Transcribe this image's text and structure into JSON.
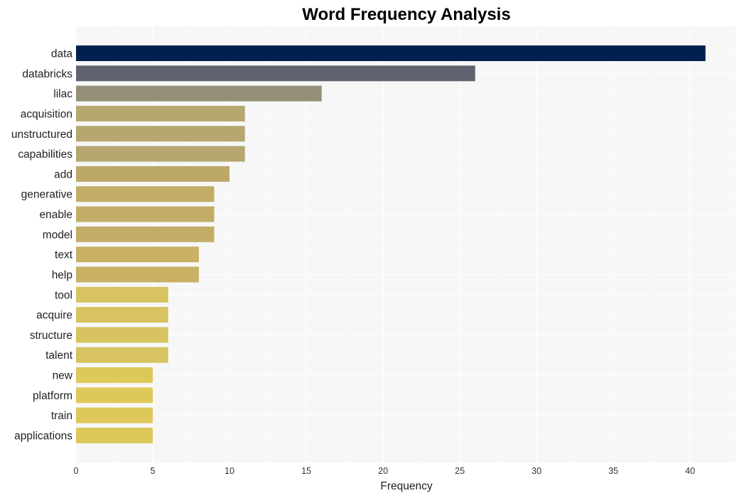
{
  "chart_data": {
    "type": "bar",
    "orientation": "horizontal",
    "title": "Word Frequency Analysis",
    "xlabel": "Frequency",
    "ylabel": "",
    "xlim": [
      0,
      43
    ],
    "xticks": [
      0,
      5,
      10,
      15,
      20,
      25,
      30,
      35,
      40
    ],
    "grid": true,
    "legend": "none",
    "categories": [
      "data",
      "databricks",
      "lilac",
      "acquisition",
      "unstructured",
      "capabilities",
      "add",
      "generative",
      "enable",
      "model",
      "text",
      "help",
      "tool",
      "acquire",
      "structure",
      "talent",
      "new",
      "platform",
      "train",
      "applications"
    ],
    "values": [
      41,
      26,
      16,
      11,
      11,
      11,
      10,
      9,
      9,
      9,
      8,
      8,
      6,
      6,
      6,
      6,
      5,
      5,
      5,
      5
    ],
    "colors": [
      "#00204d",
      "#5f6370",
      "#958f77",
      "#b5a76f",
      "#b5a76f",
      "#b5a76f",
      "#bca96a",
      "#c2ad67",
      "#c2ad67",
      "#c2ad67",
      "#c8b165",
      "#c8b165",
      "#d7c35f",
      "#d7c35f",
      "#d7c35f",
      "#d7c35f",
      "#dfc85a",
      "#dfc85a",
      "#dfc85a",
      "#dfc85a"
    ],
    "plot_background": "#f7f7f7",
    "grid_color": "#ffffff"
  }
}
